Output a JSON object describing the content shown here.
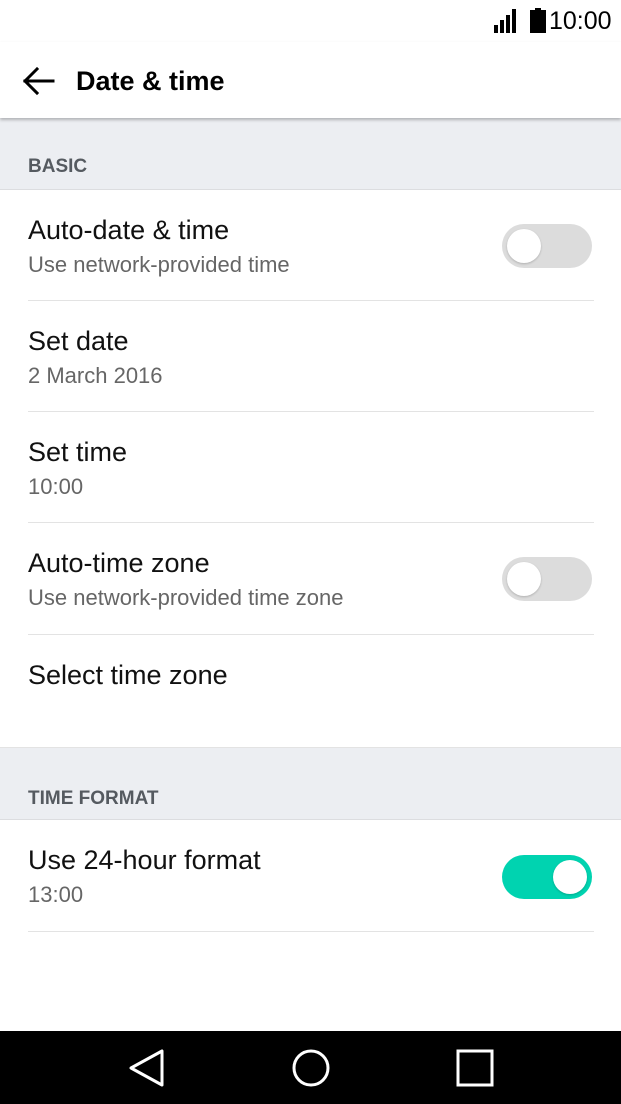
{
  "status_bar": {
    "time": "10:00",
    "signal_icon": "signal-icon",
    "battery_icon": "battery-icon"
  },
  "app_bar": {
    "title": "Date & time",
    "back_icon": "arrow-back-icon"
  },
  "sections": {
    "basic": "BASIC",
    "time_format": "TIME FORMAT"
  },
  "settings": {
    "auto_date_time": {
      "title": "Auto-date & time",
      "subtitle": "Use network-provided time",
      "enabled": false
    },
    "set_date": {
      "title": "Set date",
      "value": "2 March 2016"
    },
    "set_time": {
      "title": "Set time",
      "value": "10:00"
    },
    "auto_time_zone": {
      "title": "Auto-time zone",
      "subtitle": "Use network-provided time zone",
      "enabled": false
    },
    "select_time_zone": {
      "title": "Select time zone"
    },
    "use_24_hour": {
      "title": "Use 24-hour format",
      "subtitle": "13:00",
      "enabled": true
    }
  },
  "colors": {
    "accent": "#00d3b0",
    "section_bg": "#eceef2",
    "toggle_off": "#dcdcdc"
  },
  "nav_bar": {
    "back_icon": "triangle-back-icon",
    "home_icon": "circle-home-icon",
    "recents_icon": "square-recents-icon"
  }
}
